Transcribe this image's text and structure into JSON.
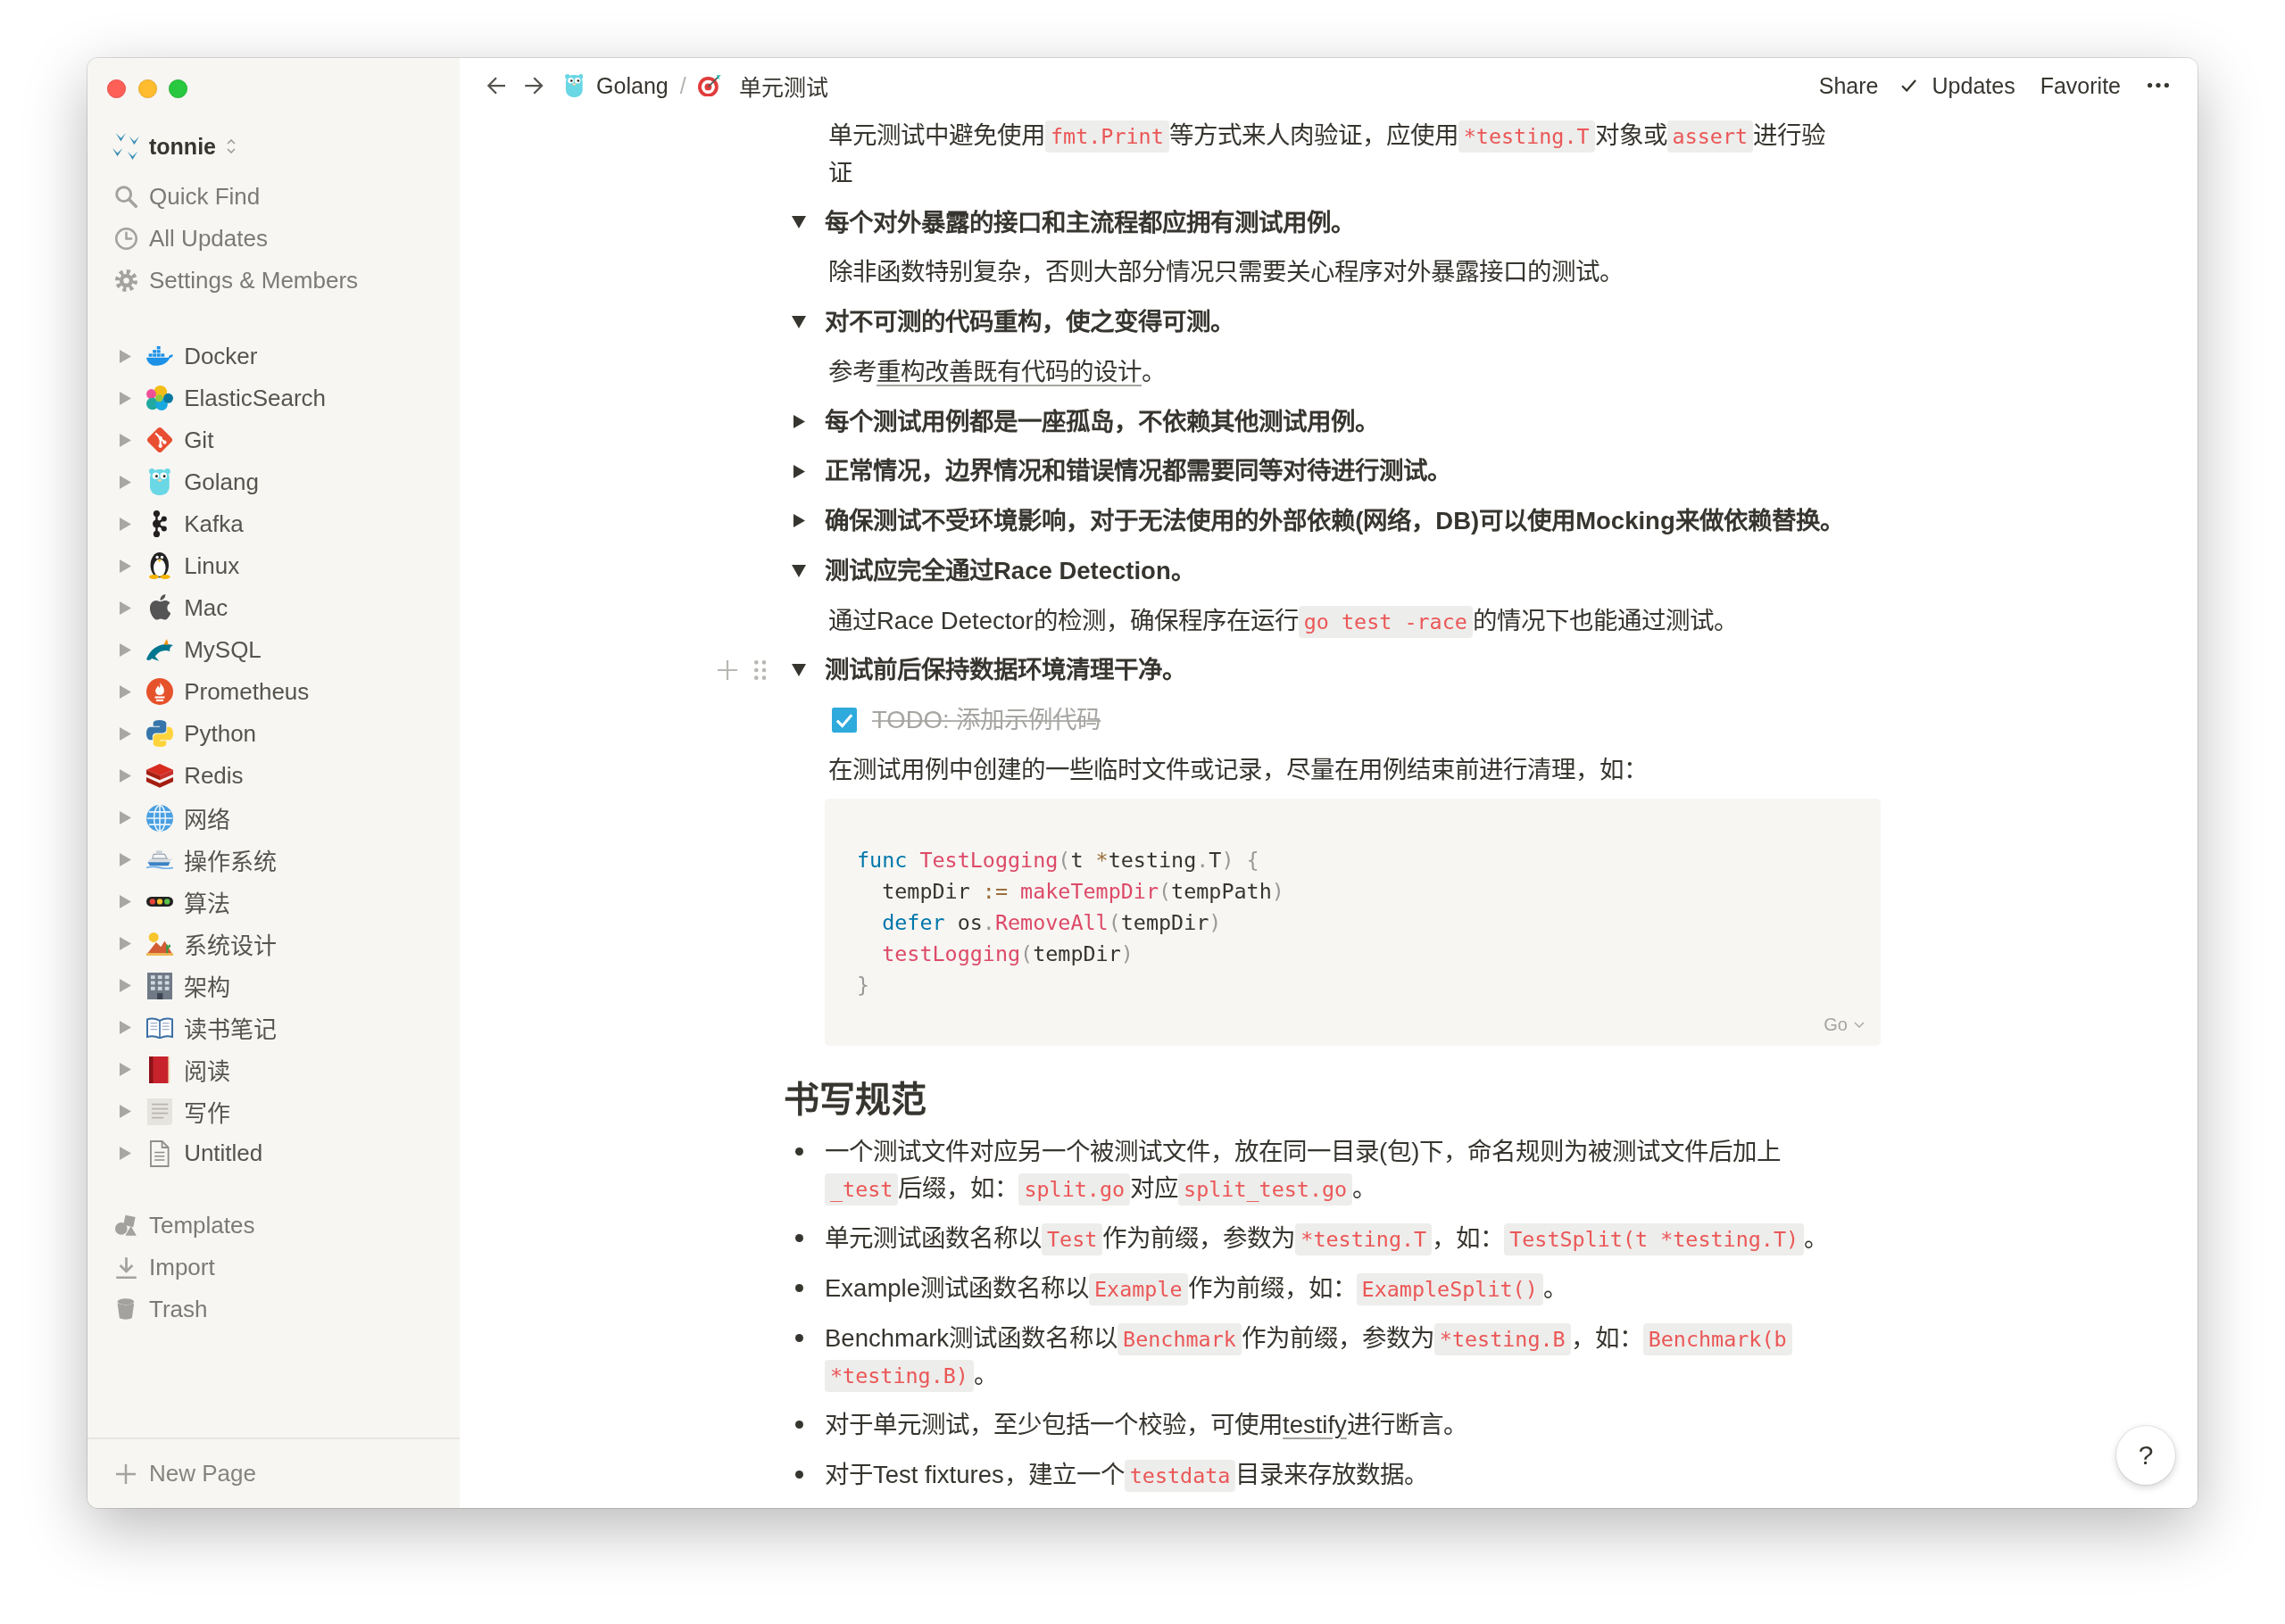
{
  "sidebar": {
    "workspace": {
      "name": "tonnie"
    },
    "nav": [
      {
        "kind": "search",
        "label": "Quick Find"
      },
      {
        "kind": "clock",
        "label": "All Updates"
      },
      {
        "kind": "gear",
        "label": "Settings & Members"
      }
    ],
    "pages": [
      {
        "kind": "whale",
        "label": "Docker",
        "expanded": false
      },
      {
        "kind": "blobs",
        "label": "ElasticSearch",
        "expanded": false
      },
      {
        "kind": "diamond",
        "label": "Git",
        "expanded": false
      },
      {
        "kind": "gopher",
        "label": "Golang",
        "expanded": false
      },
      {
        "kind": "nodes",
        "label": "Kafka",
        "expanded": false
      },
      {
        "kind": "penguin",
        "label": "Linux",
        "expanded": false
      },
      {
        "kind": "apple",
        "label": "Mac",
        "expanded": false
      },
      {
        "kind": "dolphin",
        "label": "MySQL",
        "expanded": false
      },
      {
        "kind": "flame",
        "label": "Prometheus",
        "expanded": false
      },
      {
        "kind": "snakes",
        "label": "Python",
        "expanded": false
      },
      {
        "kind": "cubes",
        "label": "Redis",
        "expanded": false
      },
      {
        "kind": "globe",
        "label": "网络",
        "expanded": false
      },
      {
        "kind": "ship",
        "label": "操作系统",
        "expanded": false
      },
      {
        "kind": "lights",
        "label": "算法",
        "expanded": false
      },
      {
        "kind": "desert",
        "label": "系统设计",
        "expanded": false
      },
      {
        "kind": "building",
        "label": "架构",
        "expanded": false
      },
      {
        "kind": "openbook",
        "label": "读书笔记",
        "expanded": false
      },
      {
        "kind": "book",
        "label": "阅读",
        "expanded": false
      },
      {
        "kind": "scroll",
        "label": "写作",
        "expanded": false
      },
      {
        "kind": "document",
        "label": "Untitled",
        "expanded": false
      }
    ],
    "footer": [
      {
        "kind": "shapes",
        "label": "Templates"
      },
      {
        "kind": "download",
        "label": "Import"
      },
      {
        "kind": "bin",
        "label": "Trash"
      }
    ],
    "new_page": {
      "label": "New Page"
    }
  },
  "topbar": {
    "breadcrumb": [
      {
        "kind": "gopher",
        "label": "Golang"
      },
      {
        "kind": "target",
        "label": "单元测试"
      }
    ],
    "separator": "/",
    "actions": [
      {
        "kind": "plain",
        "label": "Share"
      },
      {
        "kind": "check",
        "label": "Updates"
      },
      {
        "kind": "plain",
        "label": "Favorite"
      }
    ]
  },
  "content": {
    "blocks": [
      {
        "kind": "continued",
        "children": [
          {
            "kind": "paragraph",
            "spans": [
              {
                "kind": "text",
                "text": "单元测试中避免使用"
              },
              {
                "kind": "code",
                "text": "fmt.Print"
              },
              {
                "kind": "text",
                "text": "等方式来人肉验证，应使用"
              },
              {
                "kind": "code",
                "text": "*testing.T"
              },
              {
                "kind": "text",
                "text": "对象或"
              },
              {
                "kind": "code",
                "text": "assert"
              },
              {
                "kind": "text",
                "text": "进行验证"
              }
            ]
          }
        ]
      },
      {
        "kind": "toggle",
        "expanded": true,
        "title": "每个对外暴露的接口和主流程都应拥有测试用例。",
        "children": [
          {
            "kind": "paragraph",
            "spans": [
              {
                "kind": "text",
                "text": "除非函数特别复杂，否则大部分情况只需要关心程序对外暴露接口的测试。"
              }
            ]
          }
        ]
      },
      {
        "kind": "toggle",
        "expanded": true,
        "title": "对不可测的代码重构，使之变得可测。",
        "children": [
          {
            "kind": "paragraph",
            "spans": [
              {
                "kind": "text",
                "text": "参考"
              },
              {
                "kind": "link",
                "text": "重构改善既有代码的设计"
              },
              {
                "kind": "text",
                "text": "。"
              }
            ]
          }
        ]
      },
      {
        "kind": "toggle",
        "expanded": false,
        "title": "每个测试用例都是一座孤岛，不依赖其他测试用例。"
      },
      {
        "kind": "toggle",
        "expanded": false,
        "title": "正常情况，边界情况和错误情况都需要同等对待进行测试。"
      },
      {
        "kind": "toggle",
        "expanded": false,
        "title": "确保测试不受环境影响，对于无法使用的外部依赖(网络，DB)可以使用Mocking来做依赖替换。"
      },
      {
        "kind": "toggle",
        "expanded": true,
        "title": "测试应完全通过Race Detection。",
        "children": [
          {
            "kind": "paragraph",
            "spans": [
              {
                "kind": "text",
                "text": "通过Race Detector的检测，确保程序在运行"
              },
              {
                "kind": "code",
                "text": "go test -race"
              },
              {
                "kind": "text",
                "text": "的情况下也能通过测试。"
              }
            ]
          }
        ]
      },
      {
        "kind": "toggle",
        "hovered": true,
        "expanded": true,
        "title": "测试前后保持数据环境清理干净。",
        "children": [
          {
            "kind": "todo",
            "checked": true,
            "text": "TODO: 添加示例代码"
          },
          {
            "kind": "paragraph",
            "spans": [
              {
                "kind": "text",
                "text": "在测试用例中创建的一些临时文件或记录，尽量在用例结束前进行清理，如："
              }
            ]
          },
          {
            "kind": "code",
            "language": "Go",
            "lines": [
              {
                "tokens": [
                  {
                    "kind": "keyword",
                    "text": "func "
                  },
                  {
                    "kind": "function",
                    "text": "TestLogging"
                  },
                  {
                    "kind": "punctuation",
                    "text": "("
                  },
                  {
                    "kind": "plain",
                    "text": "t "
                  },
                  {
                    "kind": "operator",
                    "text": "*"
                  },
                  {
                    "kind": "plain",
                    "text": "testing"
                  },
                  {
                    "kind": "punctuation",
                    "text": "."
                  },
                  {
                    "kind": "plain",
                    "text": "T"
                  },
                  {
                    "kind": "punctuation",
                    "text": ") {"
                  }
                ]
              },
              {
                "tokens": [
                  {
                    "kind": "plain",
                    "text": "  tempDir "
                  },
                  {
                    "kind": "operator",
                    "text": ":= "
                  },
                  {
                    "kind": "function",
                    "text": "makeTempDir"
                  },
                  {
                    "kind": "punctuation",
                    "text": "("
                  },
                  {
                    "kind": "plain",
                    "text": "tempPath"
                  },
                  {
                    "kind": "punctuation",
                    "text": ")"
                  }
                ]
              },
              {
                "tokens": [
                  {
                    "kind": "keyword",
                    "text": "  defer"
                  },
                  {
                    "kind": "plain",
                    "text": " os"
                  },
                  {
                    "kind": "punctuation",
                    "text": "."
                  },
                  {
                    "kind": "function",
                    "text": "RemoveAll"
                  },
                  {
                    "kind": "punctuation",
                    "text": "("
                  },
                  {
                    "kind": "plain",
                    "text": "tempDir"
                  },
                  {
                    "kind": "punctuation",
                    "text": ")"
                  }
                ]
              },
              {
                "tokens": [
                  {
                    "kind": "function",
                    "text": "  testLogging"
                  },
                  {
                    "kind": "punctuation",
                    "text": "("
                  },
                  {
                    "kind": "plain",
                    "text": "tempDir"
                  },
                  {
                    "kind": "punctuation",
                    "text": ")"
                  }
                ]
              },
              {
                "tokens": [
                  {
                    "kind": "punctuation",
                    "text": "}"
                  }
                ]
              }
            ]
          }
        ]
      },
      {
        "kind": "heading",
        "text": "书写规范"
      },
      {
        "kind": "bullet",
        "spans": [
          {
            "kind": "text",
            "text": "一个测试文件对应另一个被测试文件，放在同一目录(包)下，命名规则为被测试文件后加上"
          },
          {
            "kind": "code",
            "text": "_test"
          },
          {
            "kind": "text",
            "text": "后缀，如："
          },
          {
            "kind": "code",
            "text": "split.go"
          },
          {
            "kind": "text",
            "text": "对应"
          },
          {
            "kind": "code",
            "text": "split_test.go"
          },
          {
            "kind": "text",
            "text": "。"
          }
        ]
      },
      {
        "kind": "bullet",
        "spans": [
          {
            "kind": "text",
            "text": "单元测试函数名称以"
          },
          {
            "kind": "code",
            "text": "Test"
          },
          {
            "kind": "text",
            "text": "作为前缀，参数为"
          },
          {
            "kind": "code",
            "text": "*testing.T"
          },
          {
            "kind": "text",
            "text": "，如："
          },
          {
            "kind": "code",
            "text": "TestSplit(t *testing.T)"
          },
          {
            "kind": "text",
            "text": "。"
          }
        ]
      },
      {
        "kind": "bullet",
        "spans": [
          {
            "kind": "text",
            "text": "Example测试函数名称以"
          },
          {
            "kind": "code",
            "text": "Example"
          },
          {
            "kind": "text",
            "text": "作为前缀，如："
          },
          {
            "kind": "code",
            "text": "ExampleSplit()"
          },
          {
            "kind": "text",
            "text": "。"
          }
        ]
      },
      {
        "kind": "bullet",
        "spans": [
          {
            "kind": "text",
            "text": "Benchmark测试函数名称以"
          },
          {
            "kind": "code",
            "text": "Benchmark"
          },
          {
            "kind": "text",
            "text": "作为前缀，参数为"
          },
          {
            "kind": "code",
            "text": "*testing.B"
          },
          {
            "kind": "text",
            "text": "，如："
          },
          {
            "kind": "code",
            "text": "Benchmark(b *testing.B)"
          },
          {
            "kind": "text",
            "text": "。"
          }
        ]
      },
      {
        "kind": "bullet",
        "spans": [
          {
            "kind": "text",
            "text": "对于单元测试，至少包括一个校验，可使用"
          },
          {
            "kind": "link",
            "text": "testify"
          },
          {
            "kind": "text",
            "text": "进行断言。"
          }
        ]
      },
      {
        "kind": "bullet",
        "spans": [
          {
            "kind": "text",
            "text": "对于Test fixtures，建立一个"
          },
          {
            "kind": "code",
            "text": "testdata"
          },
          {
            "kind": "text",
            "text": "目录来存放数据。"
          }
        ]
      }
    ]
  },
  "help": {
    "label": "?"
  }
}
